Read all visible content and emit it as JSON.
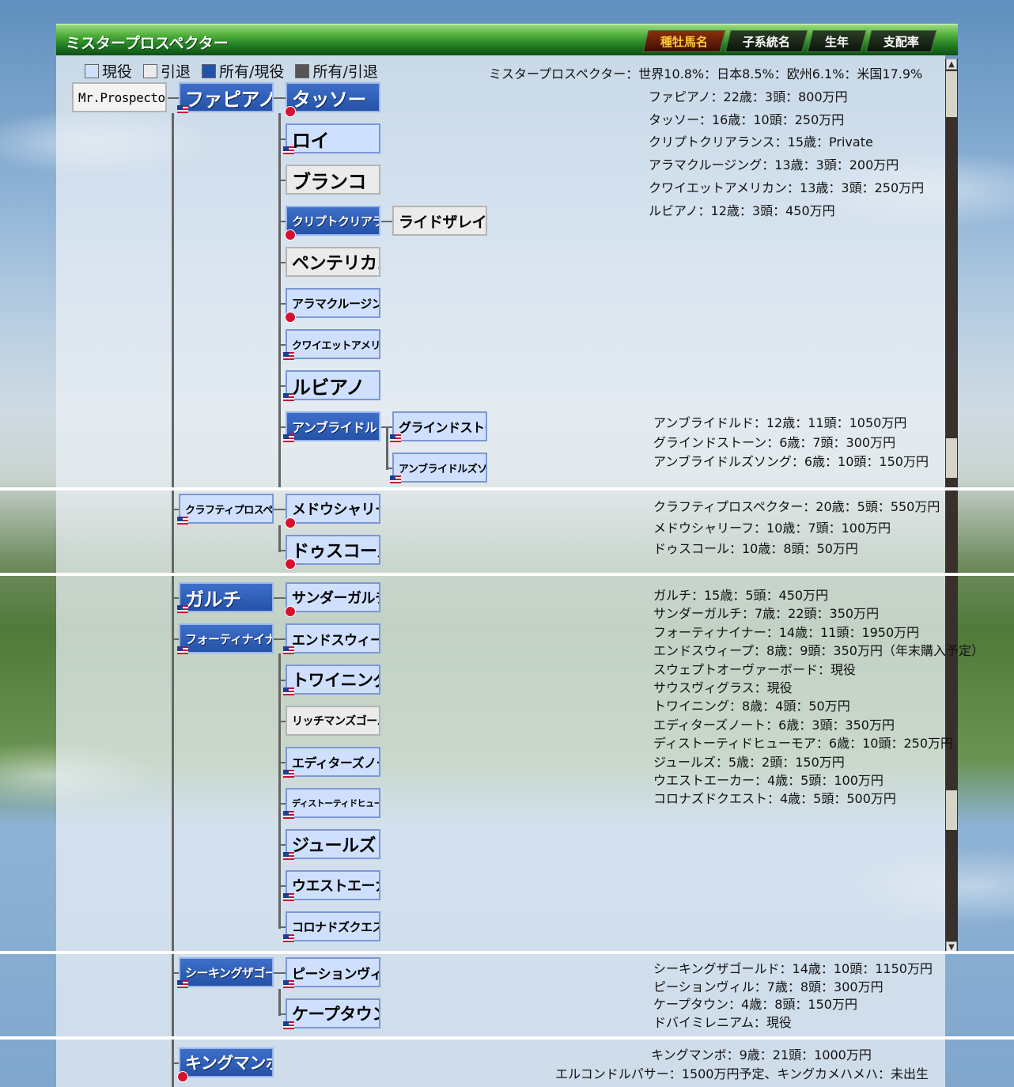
{
  "title": "ミスタープロスペクター",
  "tabs": [
    {
      "label": "種牡馬名",
      "active": true
    },
    {
      "label": "子系統名",
      "active": false
    },
    {
      "label": "生年",
      "active": false
    },
    {
      "label": "支配率",
      "active": false
    }
  ],
  "legend": [
    {
      "label": "現役",
      "color": "#cfe0ff"
    },
    {
      "label": "引退",
      "color": "#ebebeb"
    },
    {
      "label": "所有/現役",
      "color": "#2452a8"
    },
    {
      "label": "所有/引退",
      "color": "#555555"
    }
  ],
  "summary": "ミスタープロスペクター：世界10.8%：日本8.5%：欧州6.1%：米国17.9%",
  "root": {
    "name": "Mr.Prospector"
  },
  "horses": [
    {
      "name": "ファピアノ",
      "status": "owned"
    },
    {
      "name": "タッソー",
      "status": "owned"
    },
    {
      "name": "ロイ",
      "status": "active"
    },
    {
      "name": "ブランコ",
      "status": "retired"
    },
    {
      "name": "クリプトクリアランス",
      "status": "owned"
    },
    {
      "name": "ライドザレイルズ",
      "status": "retired"
    },
    {
      "name": "ペンテリカス",
      "status": "retired"
    },
    {
      "name": "アラマクルージング",
      "status": "active"
    },
    {
      "name": "クワイエットアメリカン",
      "status": "active"
    },
    {
      "name": "ルビアノ",
      "status": "active"
    },
    {
      "name": "アンブライドルド",
      "status": "owned"
    },
    {
      "name": "グラインドストーン",
      "status": "active"
    },
    {
      "name": "アンブライドルズソング",
      "status": "active"
    },
    {
      "name": "クラフティプロスペクター",
      "status": "active"
    },
    {
      "name": "メドウシャリーフ",
      "status": "active"
    },
    {
      "name": "ドゥスコール",
      "status": "active"
    },
    {
      "name": "ガルチ",
      "status": "owned"
    },
    {
      "name": "サンダーガルチ",
      "status": "active"
    },
    {
      "name": "フォーティナイナー",
      "status": "owned"
    },
    {
      "name": "エンドスウィープ",
      "status": "active"
    },
    {
      "name": "トワイニング",
      "status": "active"
    },
    {
      "name": "リッチマンズゴールド",
      "status": "retired"
    },
    {
      "name": "エディターズノート",
      "status": "active"
    },
    {
      "name": "ディストーティドヒューモア",
      "status": "active"
    },
    {
      "name": "ジュールズ",
      "status": "active"
    },
    {
      "name": "ウエストエーカー",
      "status": "active"
    },
    {
      "name": "コロナドズクエスト",
      "status": "active"
    },
    {
      "name": "シーキングザゴールド",
      "status": "owned"
    },
    {
      "name": "ピーションヴィル",
      "status": "active"
    },
    {
      "name": "ケープタウン",
      "status": "active"
    },
    {
      "name": "キングマンボ",
      "status": "owned"
    }
  ],
  "info": [
    [
      "ファピアノ：22歳：3頭：800万円",
      "タッソー：16歳：10頭：250万円",
      "クリプトクリアランス：15歳：Private",
      "アラマクルージング：13歳：3頭：200万円",
      "クワイエットアメリカン：13歳：3頭：250万円",
      "ルビアノ：12歳：3頭：450万円"
    ],
    [
      "アンブライドルド：12歳：11頭：1050万円",
      "グラインドストーン：6歳：7頭：300万円",
      "アンブライドルズソング：6歳：10頭：150万円"
    ],
    [
      "クラフティプロスペクター：20歳：5頭：550万円",
      "メドウシャリーフ：10歳：7頭：100万円",
      "ドゥスコール：10歳：8頭：50万円"
    ],
    [
      "ガルチ：15歳：5頭：450万円",
      "サンダーガルチ：7歳：22頭：350万円",
      "フォーティナイナー：14歳：11頭：1950万円",
      "エンドスウィープ：8歳：9頭：350万円（年末購入予定）",
      "スウェプトオーヴァーボード：現役",
      "サウスヴィグラス：現役",
      "トワイニング：8歳：4頭：50万円",
      "エディターズノート：6歳：3頭：350万円",
      "ディストーティドヒューモア：6歳：10頭：250万円",
      "ジュールズ：5歳：2頭：150万円",
      "ウエストエーカー：4歳：5頭：100万円",
      "コロナズドクエスト：4歳：5頭：500万円"
    ],
    [
      "シーキングザゴールド：14歳：10頭：1150万円",
      "ピーションヴィル：7歳：8頭：300万円",
      "ケープタウン：4歳：8頭：150万円",
      "ドバイミレニアム：現役"
    ],
    [
      "キングマンボ：9歳：21頭：1000万円",
      "エルコンドルパサー：1500万円予定、キングカメハメハ：未出生"
    ]
  ]
}
